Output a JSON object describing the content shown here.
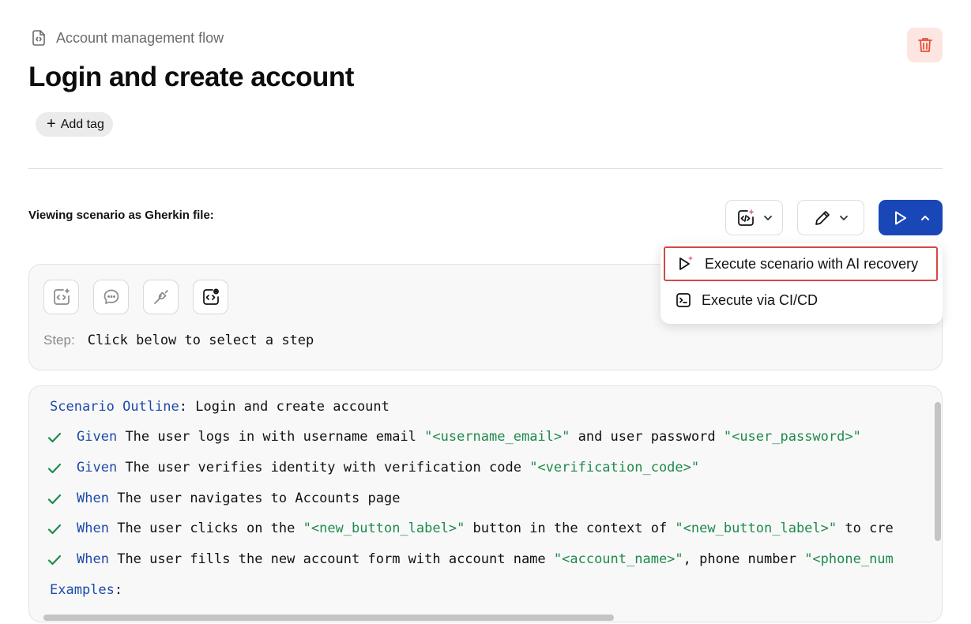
{
  "header": {
    "breadcrumb": "Account management flow",
    "title": "Login and create account",
    "add_tag_label": "Add tag",
    "delete_color": "#e8513a"
  },
  "toolbar": {
    "view_label": "Viewing scenario as Gherkin file:",
    "accent_color": "#1a47b8"
  },
  "run_menu": {
    "items": [
      {
        "label": "Execute scenario with AI recovery",
        "icon": "play-sparkle-icon"
      },
      {
        "label": "Execute via CI/CD",
        "icon": "terminal-icon"
      }
    ]
  },
  "step_panel": {
    "icons": [
      "ai-code-icon",
      "chat-icon",
      "plug-icon",
      "code-settings-icon"
    ],
    "label": "Step:",
    "text": "Click below to select a step"
  },
  "gherkin": {
    "outline_keyword": "Scenario Outline",
    "outline_title": "Login and create account",
    "steps": [
      {
        "keyword": "Given",
        "status": "passed",
        "parts": [
          {
            "text": "The user logs in with username email ",
            "type": "text"
          },
          {
            "text": "\"<username_email>\"",
            "type": "str"
          },
          {
            "text": " and user password ",
            "type": "text"
          },
          {
            "text": "\"<user_password>\"",
            "type": "str"
          }
        ]
      },
      {
        "keyword": "Given",
        "status": "passed",
        "parts": [
          {
            "text": "The user verifies identity with verification code ",
            "type": "text"
          },
          {
            "text": "\"<verification_code>\"",
            "type": "str"
          }
        ]
      },
      {
        "keyword": "When",
        "status": "passed",
        "parts": [
          {
            "text": "The user navigates to Accounts page",
            "type": "text"
          }
        ]
      },
      {
        "keyword": "When",
        "status": "passed",
        "parts": [
          {
            "text": "The user clicks on the ",
            "type": "text"
          },
          {
            "text": "\"<new_button_label>\"",
            "type": "str"
          },
          {
            "text": " button in the context of ",
            "type": "text"
          },
          {
            "text": "\"<new_button_label>\"",
            "type": "str"
          },
          {
            "text": " to cre",
            "type": "text"
          }
        ]
      },
      {
        "keyword": "When",
        "status": "passed",
        "parts": [
          {
            "text": "The user fills the new account form with account name ",
            "type": "text"
          },
          {
            "text": "\"<account_name>\"",
            "type": "str"
          },
          {
            "text": ", phone number ",
            "type": "text"
          },
          {
            "text": "\"<phone_num",
            "type": "str"
          }
        ]
      }
    ],
    "examples_keyword": "Examples",
    "keyword_color": "#1e4aa8",
    "string_color": "#1f8a4c",
    "check_color": "#1f8a4c"
  }
}
